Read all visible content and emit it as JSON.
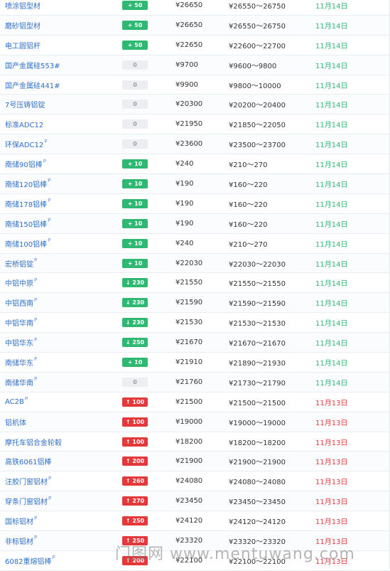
{
  "rows": [
    {
      "name": "喷涂铝型材",
      "sup": "",
      "change": "+ 50",
      "dir": "up-green",
      "price": "¥26650",
      "range": "¥26550～26750",
      "date": "11月14日"
    },
    {
      "name": "磨砂铝型材",
      "sup": "",
      "change": "+ 50",
      "dir": "up-green",
      "price": "¥26650",
      "range": "¥26550～26750",
      "date": "11月14日"
    },
    {
      "name": "电工圆铝杆",
      "sup": "",
      "change": "+ 50",
      "dir": "up-green",
      "price": "¥22650",
      "range": "¥22600～22700",
      "date": "11月14日"
    },
    {
      "name": "国产金属硅553#",
      "sup": "",
      "change": "0",
      "dir": "flat",
      "price": "¥9700",
      "range": "¥9600～9800",
      "date": "11月14日"
    },
    {
      "name": "国产金属硅441#",
      "sup": "",
      "change": "0",
      "dir": "flat",
      "price": "¥9900",
      "range": "¥9800～10000",
      "date": "11月14日"
    },
    {
      "name": "7号压铸铝锭",
      "sup": "",
      "change": "0",
      "dir": "flat",
      "price": "¥20300",
      "range": "¥20200～20400",
      "date": "11月14日"
    },
    {
      "name": "标准ADC12",
      "sup": "",
      "change": "0",
      "dir": "flat",
      "price": "¥21950",
      "range": "¥21850～22050",
      "date": "11月14日"
    },
    {
      "name": "环保ADC12",
      "sup": "P",
      "change": "0",
      "dir": "flat",
      "price": "¥23600",
      "range": "¥23500～23700",
      "date": "11月14日"
    },
    {
      "name": "南储90铝棒",
      "sup": "P",
      "change": "+ 10",
      "dir": "up-green",
      "price": "¥240",
      "range": "¥210～270",
      "date": "11月14日"
    },
    {
      "name": "南储120铝棒",
      "sup": "P",
      "change": "+ 10",
      "dir": "up-green",
      "price": "¥190",
      "range": "¥160～220",
      "date": "11月14日"
    },
    {
      "name": "南储178铝棒",
      "sup": "P",
      "change": "+ 10",
      "dir": "up-green",
      "price": "¥190",
      "range": "¥160～220",
      "date": "11月14日"
    },
    {
      "name": "南储150铝棒",
      "sup": "P",
      "change": "+ 10",
      "dir": "up-green",
      "price": "¥190",
      "range": "¥160～220",
      "date": "11月14日"
    },
    {
      "name": "南储100铝棒",
      "sup": "P",
      "change": "+ 10",
      "dir": "up-green",
      "price": "¥240",
      "range": "¥210～270",
      "date": "11月14日"
    },
    {
      "name": "宏桥铝锭",
      "sup": "P",
      "change": "+ 10",
      "dir": "up-green",
      "price": "¥22030",
      "range": "¥22030～22030",
      "date": "11月14日"
    },
    {
      "name": "中铝中原",
      "sup": "P",
      "change": "↓ 230",
      "dir": "down",
      "price": "¥21550",
      "range": "¥21550～21550",
      "date": "11月14日"
    },
    {
      "name": "中铝西南",
      "sup": "P",
      "change": "↓ 230",
      "dir": "down",
      "price": "¥21590",
      "range": "¥21590～21590",
      "date": "11月14日"
    },
    {
      "name": "中铝华南",
      "sup": "P",
      "change": "↓ 230",
      "dir": "down",
      "price": "¥21530",
      "range": "¥21530～21530",
      "date": "11月14日"
    },
    {
      "name": "中铝华东",
      "sup": "P",
      "change": "↓ 250",
      "dir": "down",
      "price": "¥21670",
      "range": "¥21670～21670",
      "date": "11月14日"
    },
    {
      "name": "南储华东",
      "sup": "P",
      "change": "+ 10",
      "dir": "up-green",
      "price": "¥21910",
      "range": "¥21890～21930",
      "date": "11月14日"
    },
    {
      "name": "南储华南",
      "sup": "P",
      "change": "0",
      "dir": "flat",
      "price": "¥21760",
      "range": "¥21730～21790",
      "date": "11月14日"
    },
    {
      "name": "AC2B",
      "sup": "P",
      "change": "↑ 100",
      "dir": "up",
      "price": "¥21500",
      "range": "¥21500～21500",
      "date": "11月13日"
    },
    {
      "name": "铝机体",
      "sup": "",
      "change": "↑ 100",
      "dir": "up",
      "price": "¥19000",
      "range": "¥19000～19000",
      "date": "11月13日"
    },
    {
      "name": "摩托车铝合金轮毂",
      "sup": "",
      "change": "↑ 100",
      "dir": "up",
      "price": "¥18200",
      "range": "¥18200～18200",
      "date": "11月13日"
    },
    {
      "name": "高铁6061铝棒",
      "sup": "",
      "change": "↑ 200",
      "dir": "up",
      "price": "¥21900",
      "range": "¥21900～21900",
      "date": "11月13日"
    },
    {
      "name": "注胶门窗铝材",
      "sup": "P",
      "change": "↑ 260",
      "dir": "up",
      "price": "¥24080",
      "range": "¥24080～24080",
      "date": "11月13日"
    },
    {
      "name": "穿条门窗铝材",
      "sup": "P",
      "change": "↑ 270",
      "dir": "up",
      "price": "¥23450",
      "range": "¥23450～23450",
      "date": "11月13日"
    },
    {
      "name": "国标铝材",
      "sup": "P",
      "change": "↑ 250",
      "dir": "up",
      "price": "¥24120",
      "range": "¥24120～24120",
      "date": "11月13日"
    },
    {
      "name": "非标铝材",
      "sup": "P",
      "change": "↑ 250",
      "dir": "up",
      "price": "¥23320",
      "range": "¥23320～23320",
      "date": "11月13日"
    },
    {
      "name": "6082重熔铝棒",
      "sup": "P",
      "change": "↑ 200",
      "dir": "up",
      "price": "¥22100",
      "range": "¥22100～22100",
      "date": "11月13日"
    }
  ],
  "watermark": "门图网 www.mentuwang.com"
}
